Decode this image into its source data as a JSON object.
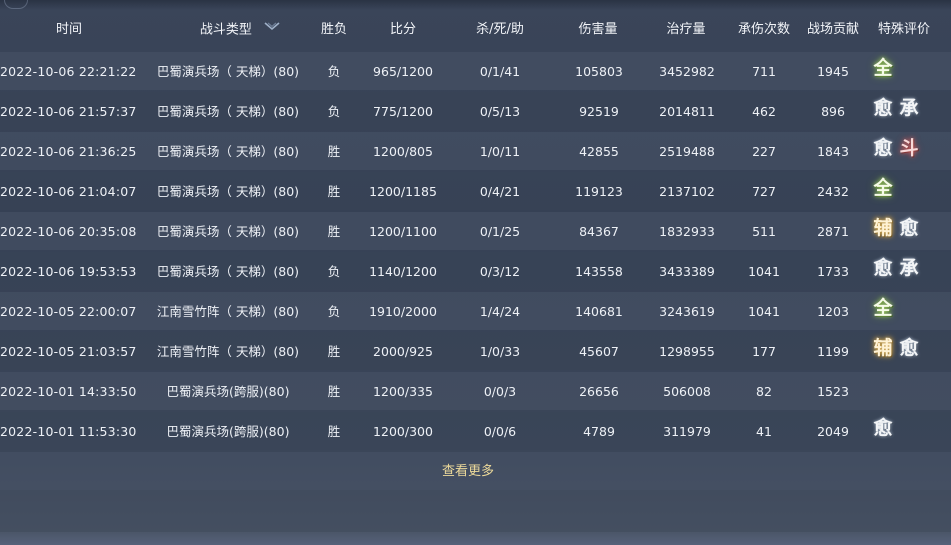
{
  "header": {
    "time": "时间",
    "type": "战斗类型",
    "result": "胜负",
    "score": "比分",
    "kda": "杀/死/助",
    "damage": "伤害量",
    "heal": "治疗量",
    "taken": "承伤次数",
    "contribution": "战场贡献",
    "special": "特殊评价"
  },
  "rows": [
    {
      "time": "2022-10-06 22:21:22",
      "type": "巴蜀演兵场（ 天梯）(80)",
      "result": "负",
      "score": "965/1200",
      "kda": "0/1/41",
      "damage": "105803",
      "heal": "3452982",
      "taken": "711",
      "contribution": "1945",
      "badges": [
        "全"
      ]
    },
    {
      "time": "2022-10-06 21:57:37",
      "type": "巴蜀演兵场（ 天梯）(80)",
      "result": "负",
      "score": "775/1200",
      "kda": "0/5/13",
      "damage": "92519",
      "heal": "2014811",
      "taken": "462",
      "contribution": "896",
      "badges": [
        "愈",
        "承"
      ]
    },
    {
      "time": "2022-10-06 21:36:25",
      "type": "巴蜀演兵场（ 天梯）(80)",
      "result": "胜",
      "score": "1200/805",
      "kda": "1/0/11",
      "damage": "42855",
      "heal": "2519488",
      "taken": "227",
      "contribution": "1843",
      "badges": [
        "愈",
        "斗"
      ]
    },
    {
      "time": "2022-10-06 21:04:07",
      "type": "巴蜀演兵场（ 天梯）(80)",
      "result": "胜",
      "score": "1200/1185",
      "kda": "0/4/21",
      "damage": "119123",
      "heal": "2137102",
      "taken": "727",
      "contribution": "2432",
      "badges": [
        "全"
      ]
    },
    {
      "time": "2022-10-06 20:35:08",
      "type": "巴蜀演兵场（ 天梯）(80)",
      "result": "胜",
      "score": "1200/1100",
      "kda": "0/1/25",
      "damage": "84367",
      "heal": "1832933",
      "taken": "511",
      "contribution": "2871",
      "badges": [
        "辅",
        "愈"
      ]
    },
    {
      "time": "2022-10-06 19:53:53",
      "type": "巴蜀演兵场（ 天梯）(80)",
      "result": "负",
      "score": "1140/1200",
      "kda": "0/3/12",
      "damage": "143558",
      "heal": "3433389",
      "taken": "1041",
      "contribution": "1733",
      "badges": [
        "愈",
        "承"
      ]
    },
    {
      "time": "2022-10-05 22:00:07",
      "type": "江南雪竹阵（ 天梯）(80)",
      "result": "负",
      "score": "1910/2000",
      "kda": "1/4/24",
      "damage": "140681",
      "heal": "3243619",
      "taken": "1041",
      "contribution": "1203",
      "badges": [
        "全"
      ]
    },
    {
      "time": "2022-10-05 21:03:57",
      "type": "江南雪竹阵（ 天梯）(80)",
      "result": "胜",
      "score": "2000/925",
      "kda": "1/0/33",
      "damage": "45607",
      "heal": "1298955",
      "taken": "177",
      "contribution": "1199",
      "badges": [
        "辅",
        "愈"
      ]
    },
    {
      "time": "2022-10-01 14:33:50",
      "type": "巴蜀演兵场(跨服)(80)",
      "result": "胜",
      "score": "1200/335",
      "kda": "0/0/3",
      "damage": "26656",
      "heal": "506008",
      "taken": "82",
      "contribution": "1523",
      "badges": []
    },
    {
      "time": "2022-10-01 11:53:30",
      "type": "巴蜀演兵场(跨服)(80)",
      "result": "胜",
      "score": "1200/300",
      "kda": "0/0/6",
      "damage": "4789",
      "heal": "311979",
      "taken": "41",
      "contribution": "2049",
      "badges": [
        "愈"
      ]
    }
  ],
  "more_label": "查看更多",
  "icons": {
    "type_dropdown": "chevron-down-icon",
    "corner_ornament": "ornament-icon"
  },
  "colors": {
    "more_link": "#ecd99a",
    "badge_quan_glow": "#a7d36a",
    "badge_dou_glow": "#d86a6a",
    "badge_fu_glow": "#d8b260"
  }
}
